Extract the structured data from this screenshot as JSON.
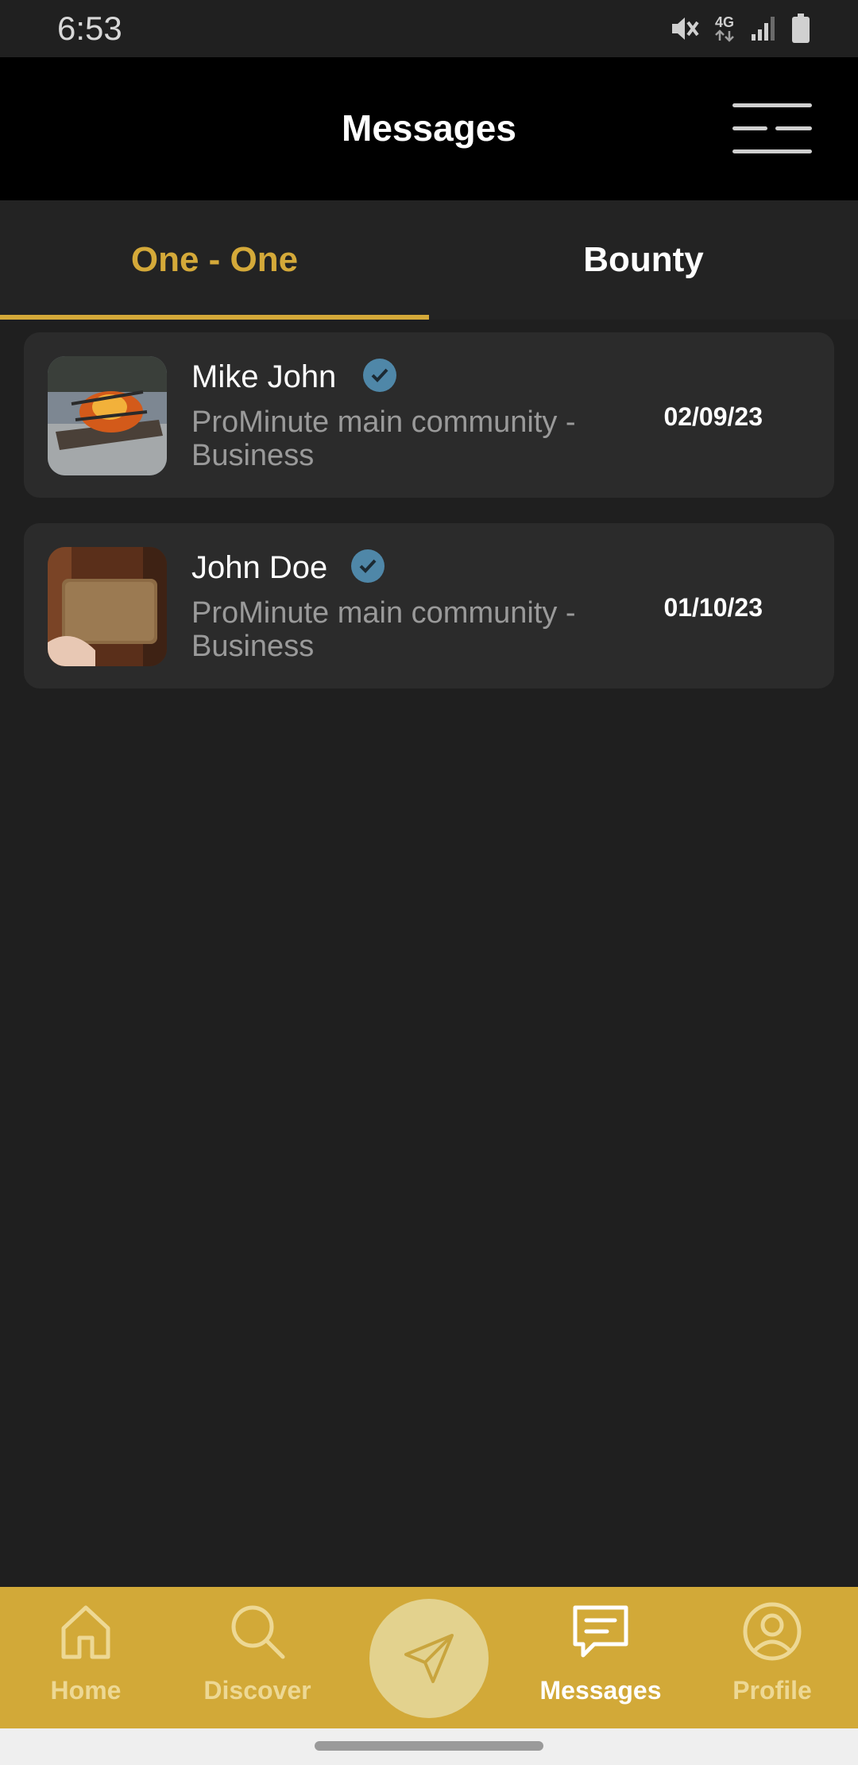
{
  "status_bar": {
    "time": "6:53",
    "network": "4G",
    "icons": [
      "mute-icon",
      "network-4g-icon",
      "signal-icon",
      "battery-icon"
    ]
  },
  "header": {
    "title": "Messages",
    "menu_icon": "hamburger-menu-icon"
  },
  "tabs": [
    {
      "label": "One - One",
      "active": true
    },
    {
      "label": "Bounty",
      "active": false
    }
  ],
  "conversations": [
    {
      "name": "Mike John",
      "verified": true,
      "subtitle": "ProMinute main community - Business",
      "date": "02/09/23",
      "avatar": "campfire-photo"
    },
    {
      "name": "John Doe",
      "verified": true,
      "subtitle": "ProMinute main community - Business",
      "date": "01/10/23",
      "avatar": "leather-wallet-photo"
    }
  ],
  "bottom_nav": [
    {
      "label": "Home",
      "icon": "home-icon",
      "active": false
    },
    {
      "label": "Discover",
      "icon": "search-icon",
      "active": false
    },
    {
      "label": "",
      "icon": "send-icon",
      "active": false
    },
    {
      "label": "Messages",
      "icon": "message-icon",
      "active": true
    },
    {
      "label": "Profile",
      "icon": "profile-icon",
      "active": false
    }
  ],
  "colors": {
    "accent": "#d4a939",
    "background": "#1f1f1f",
    "card": "#2b2b2b",
    "verified": "#4f87a8",
    "nav_bar": "#d2a938"
  }
}
